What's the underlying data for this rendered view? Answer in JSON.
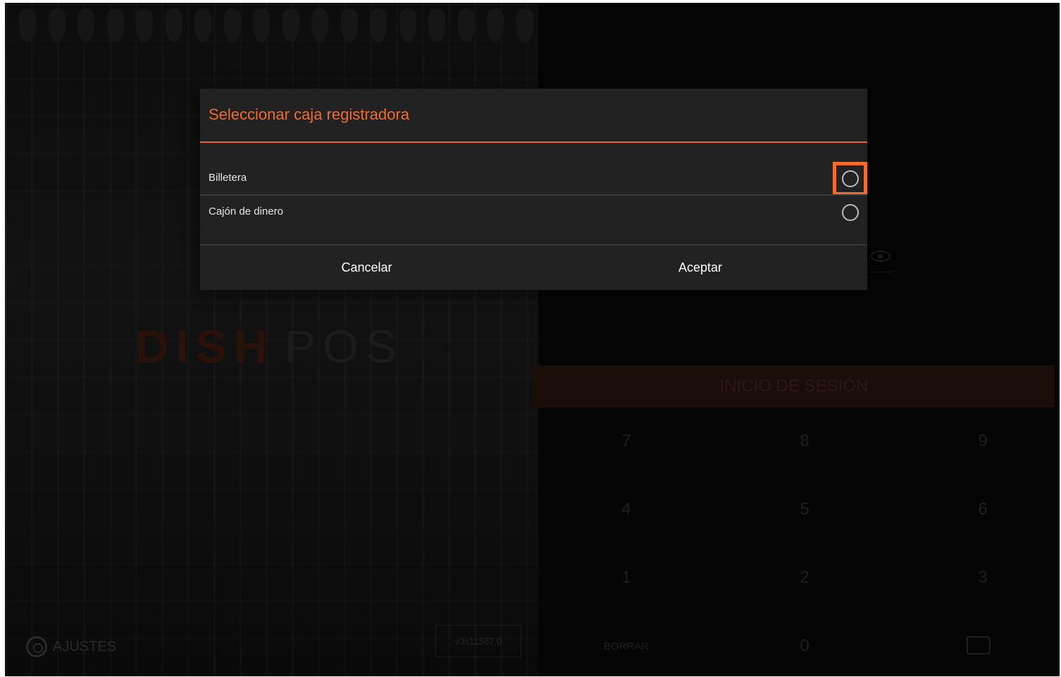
{
  "background": {
    "logo": {
      "dish": "DISH",
      "pos": "POS"
    },
    "settings_label": "AJUSTES",
    "version": "v3s11567.0",
    "login_label": "INICIO DE SESIÓN",
    "keypad": {
      "row1": [
        "7",
        "8",
        "9"
      ],
      "row2": [
        "4",
        "5",
        "6"
      ],
      "row3": [
        "1",
        "2",
        "3"
      ],
      "bottom_left": "BORRAR",
      "bottom_middle": "0"
    }
  },
  "dialog": {
    "title": "Seleccionar caja registradora",
    "options": [
      {
        "label": "Billetera",
        "selected": false,
        "highlighted": true
      },
      {
        "label": "Cajón de dinero",
        "selected": false,
        "highlighted": false
      }
    ],
    "cancel_label": "Cancelar",
    "accept_label": "Aceptar"
  },
  "colors": {
    "accent": "#f26a2e",
    "dialog_bg": "#222222",
    "highlight": "#f36b2f"
  }
}
